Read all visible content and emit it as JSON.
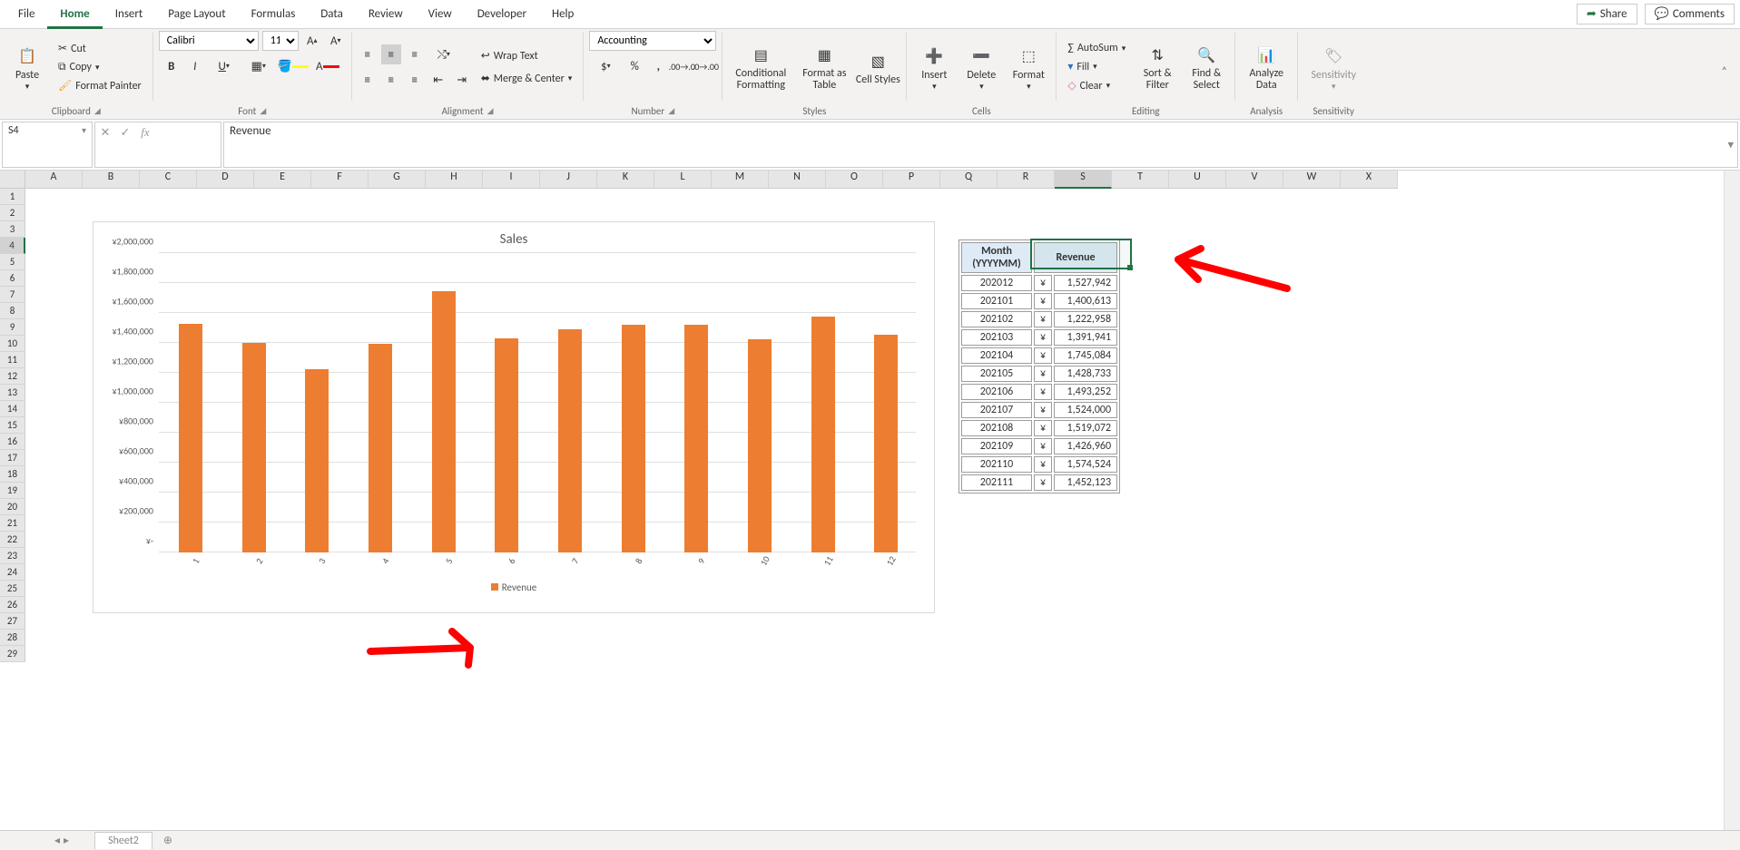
{
  "tabs": {
    "items": [
      "File",
      "Home",
      "Insert",
      "Page Layout",
      "Formulas",
      "Data",
      "Review",
      "View",
      "Developer",
      "Help"
    ],
    "active": "Home",
    "share": "Share",
    "comments": "Comments"
  },
  "ribbon": {
    "clipboard": {
      "paste": "Paste",
      "cut": "Cut",
      "copy": "Copy",
      "format_painter": "Format Painter",
      "label": "Clipboard"
    },
    "font": {
      "name": "Calibri",
      "size": "11",
      "label": "Font"
    },
    "alignment": {
      "wrap_text": "Wrap Text",
      "merge_center": "Merge & Center",
      "label": "Alignment"
    },
    "number": {
      "format": "Accounting",
      "label": "Number"
    },
    "styles": {
      "conditional": "Conditional Formatting",
      "format_table": "Format as Table",
      "cell_styles": "Cell Styles",
      "label": "Styles"
    },
    "cells": {
      "insert": "Insert",
      "delete": "Delete",
      "format": "Format",
      "label": "Cells"
    },
    "editing": {
      "autosum": "AutoSum",
      "fill": "Fill",
      "clear": "Clear",
      "sort_filter": "Sort & Filter",
      "find_select": "Find & Select",
      "label": "Editing"
    },
    "analysis": {
      "analyze": "Analyze Data",
      "label": "Analysis"
    },
    "sensitivity": {
      "btn": "Sensitivity",
      "label": "Sensitivity"
    }
  },
  "name_box": "S4",
  "formula_bar": "Revenue",
  "columns": [
    "A",
    "B",
    "C",
    "D",
    "E",
    "F",
    "G",
    "H",
    "I",
    "J",
    "K",
    "L",
    "M",
    "N",
    "O",
    "P",
    "Q",
    "R",
    "S",
    "T",
    "U",
    "V",
    "W",
    "X"
  ],
  "rows_visible": 29,
  "selected_row": 4,
  "selected_col": "S",
  "chart": {
    "title": "Sales",
    "legend": "Revenue",
    "ylabels": [
      "¥-",
      "¥200,000",
      "¥400,000",
      "¥600,000",
      "¥800,000",
      "¥1,000,000",
      "¥1,200,000",
      "¥1,400,000",
      "¥1,600,000",
      "¥1,800,000",
      "¥2,000,000"
    ]
  },
  "chart_data": {
    "type": "bar",
    "title": "Sales",
    "ylabel": "Revenue",
    "ylim": [
      0,
      2000000
    ],
    "categories": [
      "1",
      "2",
      "3",
      "4",
      "5",
      "6",
      "7",
      "8",
      "9",
      "10",
      "11",
      "12"
    ],
    "values": [
      1527942,
      1400613,
      1222958,
      1391941,
      1745084,
      1428733,
      1493252,
      1524000,
      1519072,
      1426960,
      1574524,
      1452123
    ],
    "series": [
      {
        "name": "Revenue",
        "values": [
          1527942,
          1400613,
          1222958,
          1391941,
          1745084,
          1428733,
          1493252,
          1524000,
          1519072,
          1426960,
          1574524,
          1452123
        ]
      }
    ]
  },
  "table": {
    "headers": [
      "Month (YYYYMM)",
      "Revenue"
    ],
    "currency": "¥",
    "rows": [
      {
        "month": "202012",
        "value": "1,527,942"
      },
      {
        "month": "202101",
        "value": "1,400,613"
      },
      {
        "month": "202102",
        "value": "1,222,958"
      },
      {
        "month": "202103",
        "value": "1,391,941"
      },
      {
        "month": "202104",
        "value": "1,745,084"
      },
      {
        "month": "202105",
        "value": "1,428,733"
      },
      {
        "month": "202106",
        "value": "1,493,252"
      },
      {
        "month": "202107",
        "value": "1,524,000"
      },
      {
        "month": "202108",
        "value": "1,519,072"
      },
      {
        "month": "202109",
        "value": "1,426,960"
      },
      {
        "month": "202110",
        "value": "1,574,524"
      },
      {
        "month": "202111",
        "value": "1,452,123"
      }
    ]
  },
  "sheet_tab": "Sheet2"
}
